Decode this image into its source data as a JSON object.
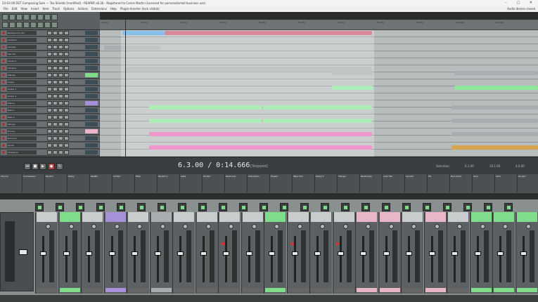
{
  "window": {
    "title": "23-03-06 DST Composing Sam — Tea Shields [modified] - REAPER v6.36 - Registered to Carlos Martin (Licensed for personal/small business use)",
    "controls": "– ▢ ✕"
  },
  "menu": {
    "items": [
      "File",
      "Edit",
      "View",
      "Insert",
      "Item",
      "Track",
      "Options",
      "Actions",
      "Extensions",
      "Help",
      "Plugin-Inserter (lock visible)"
    ],
    "status": "Audio device closed"
  },
  "tracks": [
    {
      "name": "Background Vox"
    },
    {
      "name": "Ambient"
    },
    {
      "name": "Sample"
    },
    {
      "name": "Tea Vox"
    },
    {
      "name": "Vocals 2"
    },
    {
      "name": "Scheme"
    },
    {
      "name": "Melody"
    },
    {
      "name": "Organ"
    },
    {
      "name": "Guitar 1"
    },
    {
      "name": "Guitar 2"
    },
    {
      "name": "Pianos"
    },
    {
      "name": "Bass 1"
    },
    {
      "name": "Bass 2"
    },
    {
      "name": "Strings"
    },
    {
      "name": "Drums"
    },
    {
      "name": "Drums 2"
    },
    {
      "name": "Synth"
    },
    {
      "name": "Ambience"
    }
  ],
  "ruler": {
    "marks": [
      "1.1.00",
      "2.1.00",
      "3.1.00",
      "4.1.00",
      "5.1.00",
      "6.1.00",
      "7.1.00",
      "8.1.00",
      "9.1.00",
      "10.1.00",
      "11.1.00"
    ]
  },
  "transport": {
    "timecode": "6.3.00 / 0:14.666",
    "state": "[Stopped]",
    "selection_label": "Selection:",
    "sel_start": "6.1.00",
    "sel_end": "10.1.00",
    "sel_len": "4.0.00"
  },
  "fx_labels": [
    "Chorus",
    "Compressor",
    "Reverb",
    "Delay",
    "ReaEQ",
    "Limiter",
    "Filter",
    "Reverb 2",
    "Gate",
    "Exciter",
    "ReaComp",
    "Saturation",
    "Phaser",
    "Tape Sim",
    "Delay 2",
    "Flanger",
    "ReaXcomp",
    "Auto Pan",
    "Spread",
    "EQ",
    "Bus Comp",
    "Glue",
    "Verb",
    "Ducker"
  ],
  "colors": {
    "blue_item": "#56a8e6",
    "red_item": "#c95c72",
    "green_item": "#8fe79c",
    "pink_item": "#ea6fbc",
    "grey_item": "#a9adaf",
    "orange_item": "#d6a54c",
    "green_accent": "#7fdc8a",
    "pink_accent": "#e8b6c8",
    "purple_accent": "#a691d9"
  }
}
